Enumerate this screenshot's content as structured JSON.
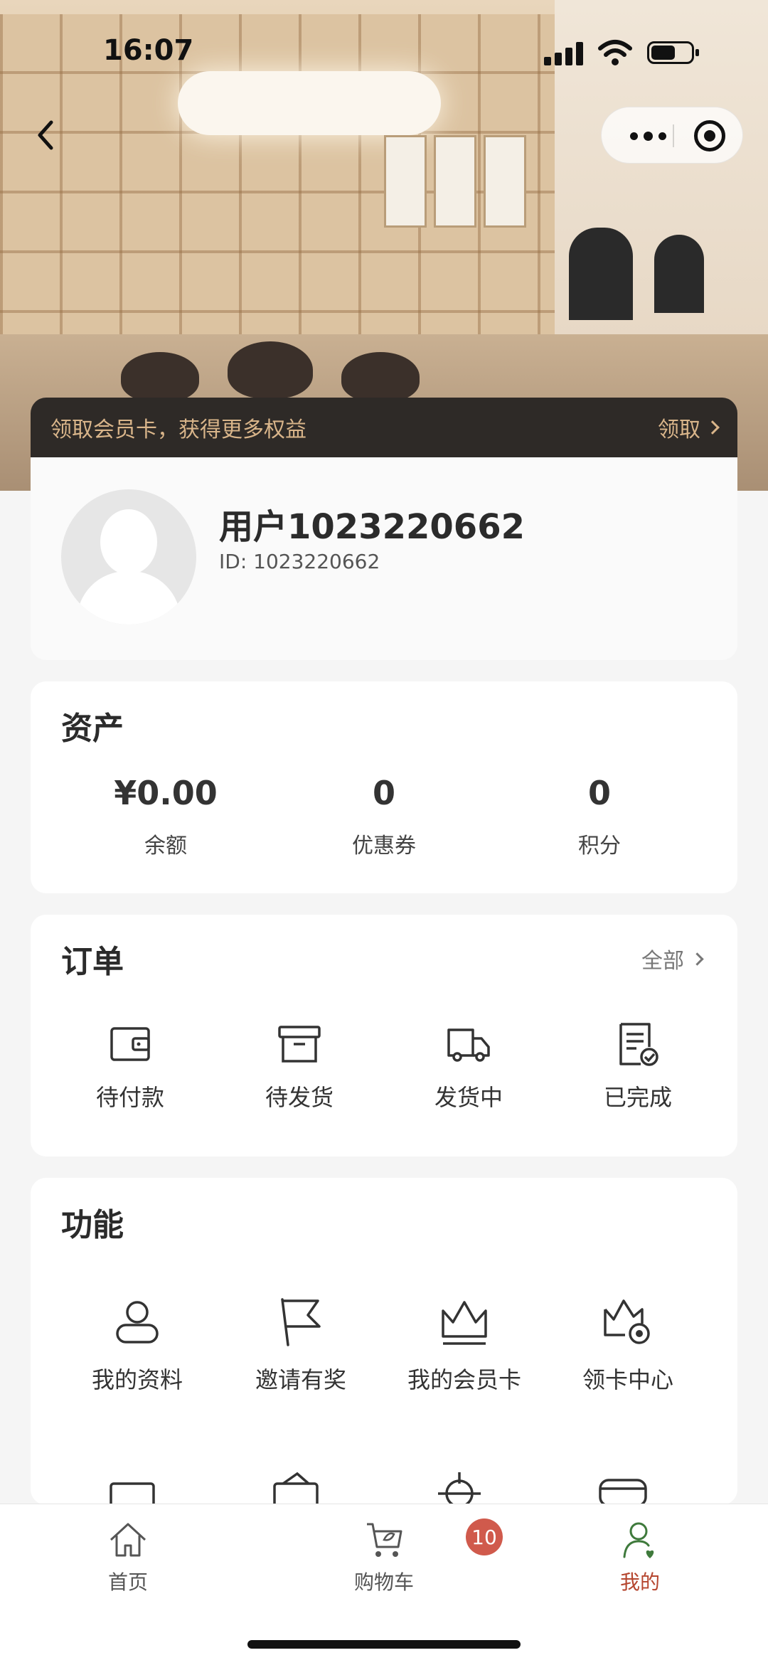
{
  "status_bar": {
    "time": "16:07"
  },
  "member_banner": {
    "text": "领取会员卡，获得更多权益",
    "action": "领取"
  },
  "profile": {
    "username": "用户1023220662",
    "id_text": "ID: 1023220662"
  },
  "assets": {
    "title": "资产",
    "items": [
      {
        "value": "¥0.00",
        "label": "余额"
      },
      {
        "value": "0",
        "label": "优惠券"
      },
      {
        "value": "0",
        "label": "积分"
      }
    ]
  },
  "orders": {
    "title": "订单",
    "view_all": "全部",
    "items": [
      {
        "label": "待付款",
        "icon": "wallet-icon"
      },
      {
        "label": "待发货",
        "icon": "box-icon"
      },
      {
        "label": "发货中",
        "icon": "truck-icon"
      },
      {
        "label": "已完成",
        "icon": "receipt-check-icon"
      }
    ]
  },
  "features": {
    "title": "功能",
    "items": [
      {
        "label": "我的资料",
        "icon": "user-profile-icon"
      },
      {
        "label": "邀请有奖",
        "icon": "flag-icon"
      },
      {
        "label": "我的会员卡",
        "icon": "crown-icon"
      },
      {
        "label": "领卡中心",
        "icon": "crown-target-icon"
      }
    ]
  },
  "tabbar": {
    "items": [
      {
        "label": "首页",
        "icon": "home-icon"
      },
      {
        "label": "购物车",
        "icon": "cart-icon"
      },
      {
        "label": "我的",
        "icon": "user-icon"
      }
    ],
    "cart_badge": "10",
    "active_color": "#b5462f"
  },
  "colors": {
    "banner_bg": "#2e2a27",
    "banner_text": "#d9b58a",
    "badge": "#d05a4c"
  }
}
